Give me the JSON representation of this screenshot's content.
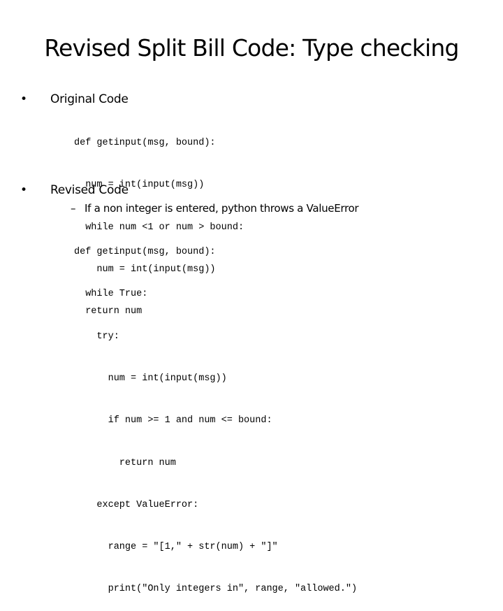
{
  "slide": {
    "title": "Revised Split Bill Code: Type checking",
    "bullets": [
      {
        "marker": "•",
        "label": "Original Code"
      },
      {
        "marker": "•",
        "label": "Revised Code",
        "sub_bullets": [
          {
            "marker": "–",
            "label": "If a non integer is entered, python throws a ValueError"
          }
        ]
      }
    ],
    "code_original": [
      "def getinput(msg, bound):",
      "  num = int(input(msg))",
      "  while num <1 or num > bound:",
      "    num = int(input(msg))",
      "  return num"
    ],
    "code_revised": [
      "def getinput(msg, bound):",
      "  while True:",
      "    try:",
      "      num = int(input(msg))",
      "      if num >= 1 and num <= bound:",
      "        return num",
      "    except ValueError:",
      "      range = \"[1,\" + str(num) + \"]\"",
      "      print(\"Only integers in\", range, \"allowed.\")"
    ]
  }
}
